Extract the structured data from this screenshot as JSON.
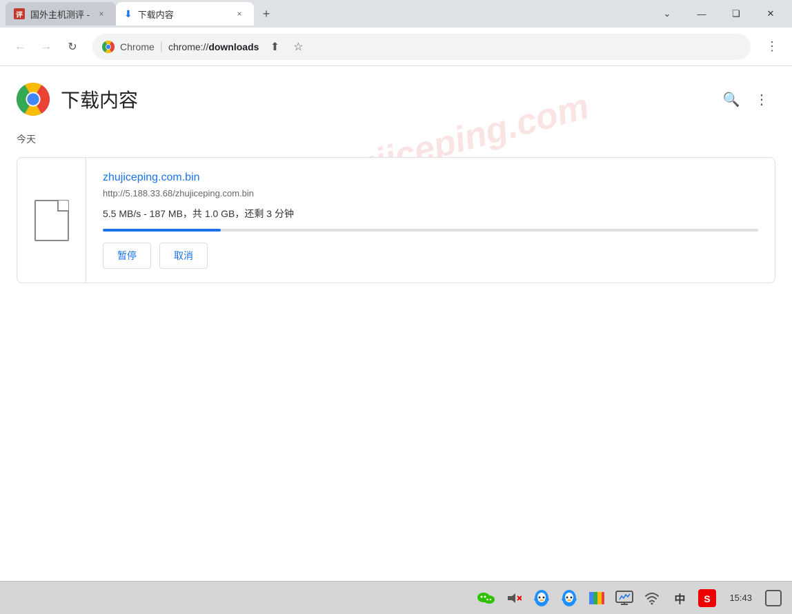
{
  "titleBar": {
    "tabInactive": {
      "label": "国外主机测评 -",
      "closeLabel": "×"
    },
    "tabActive": {
      "label": "下载内容",
      "closeLabel": "×"
    },
    "newTabLabel": "+",
    "windowControls": {
      "minimize": "—",
      "restore": "❑",
      "close": "✕",
      "chevron": "⌄"
    }
  },
  "navBar": {
    "backBtn": "←",
    "forwardBtn": "→",
    "refreshBtn": "↻",
    "addressLabel": "Chrome",
    "addressSeparator": "|",
    "addressUrl": "chrome://downloads",
    "shareIcon": "⬆",
    "bookmarkIcon": "☆",
    "menuIcon": "⋮"
  },
  "page": {
    "title": "下载内容",
    "searchIcon": "🔍",
    "menuIcon": "⋮",
    "watermark": "zhujiceping.com",
    "todayLabel": "今天",
    "download": {
      "filename": "zhujiceping.com.bin",
      "url": "http://5.188.33.68/zhujiceping.com.bin",
      "progressText": "5.5 MB/s - 187 MB，共 1.0 GB，还剩 3 分钟",
      "progressPercent": 18,
      "pauseBtn": "暂停",
      "cancelBtn": "取消"
    }
  },
  "taskbar": {
    "wechatIcon": "💬",
    "muteIcon": "🔇",
    "qqIcon": "🐧",
    "qq2Icon": "🐧",
    "colorIcon": "🎨",
    "screenIcon": "🖥",
    "wifiIcon": "📶",
    "chineseIcon": "中",
    "sogouIcon": "S",
    "time": "15:43",
    "notifyIcon": "🗨"
  }
}
